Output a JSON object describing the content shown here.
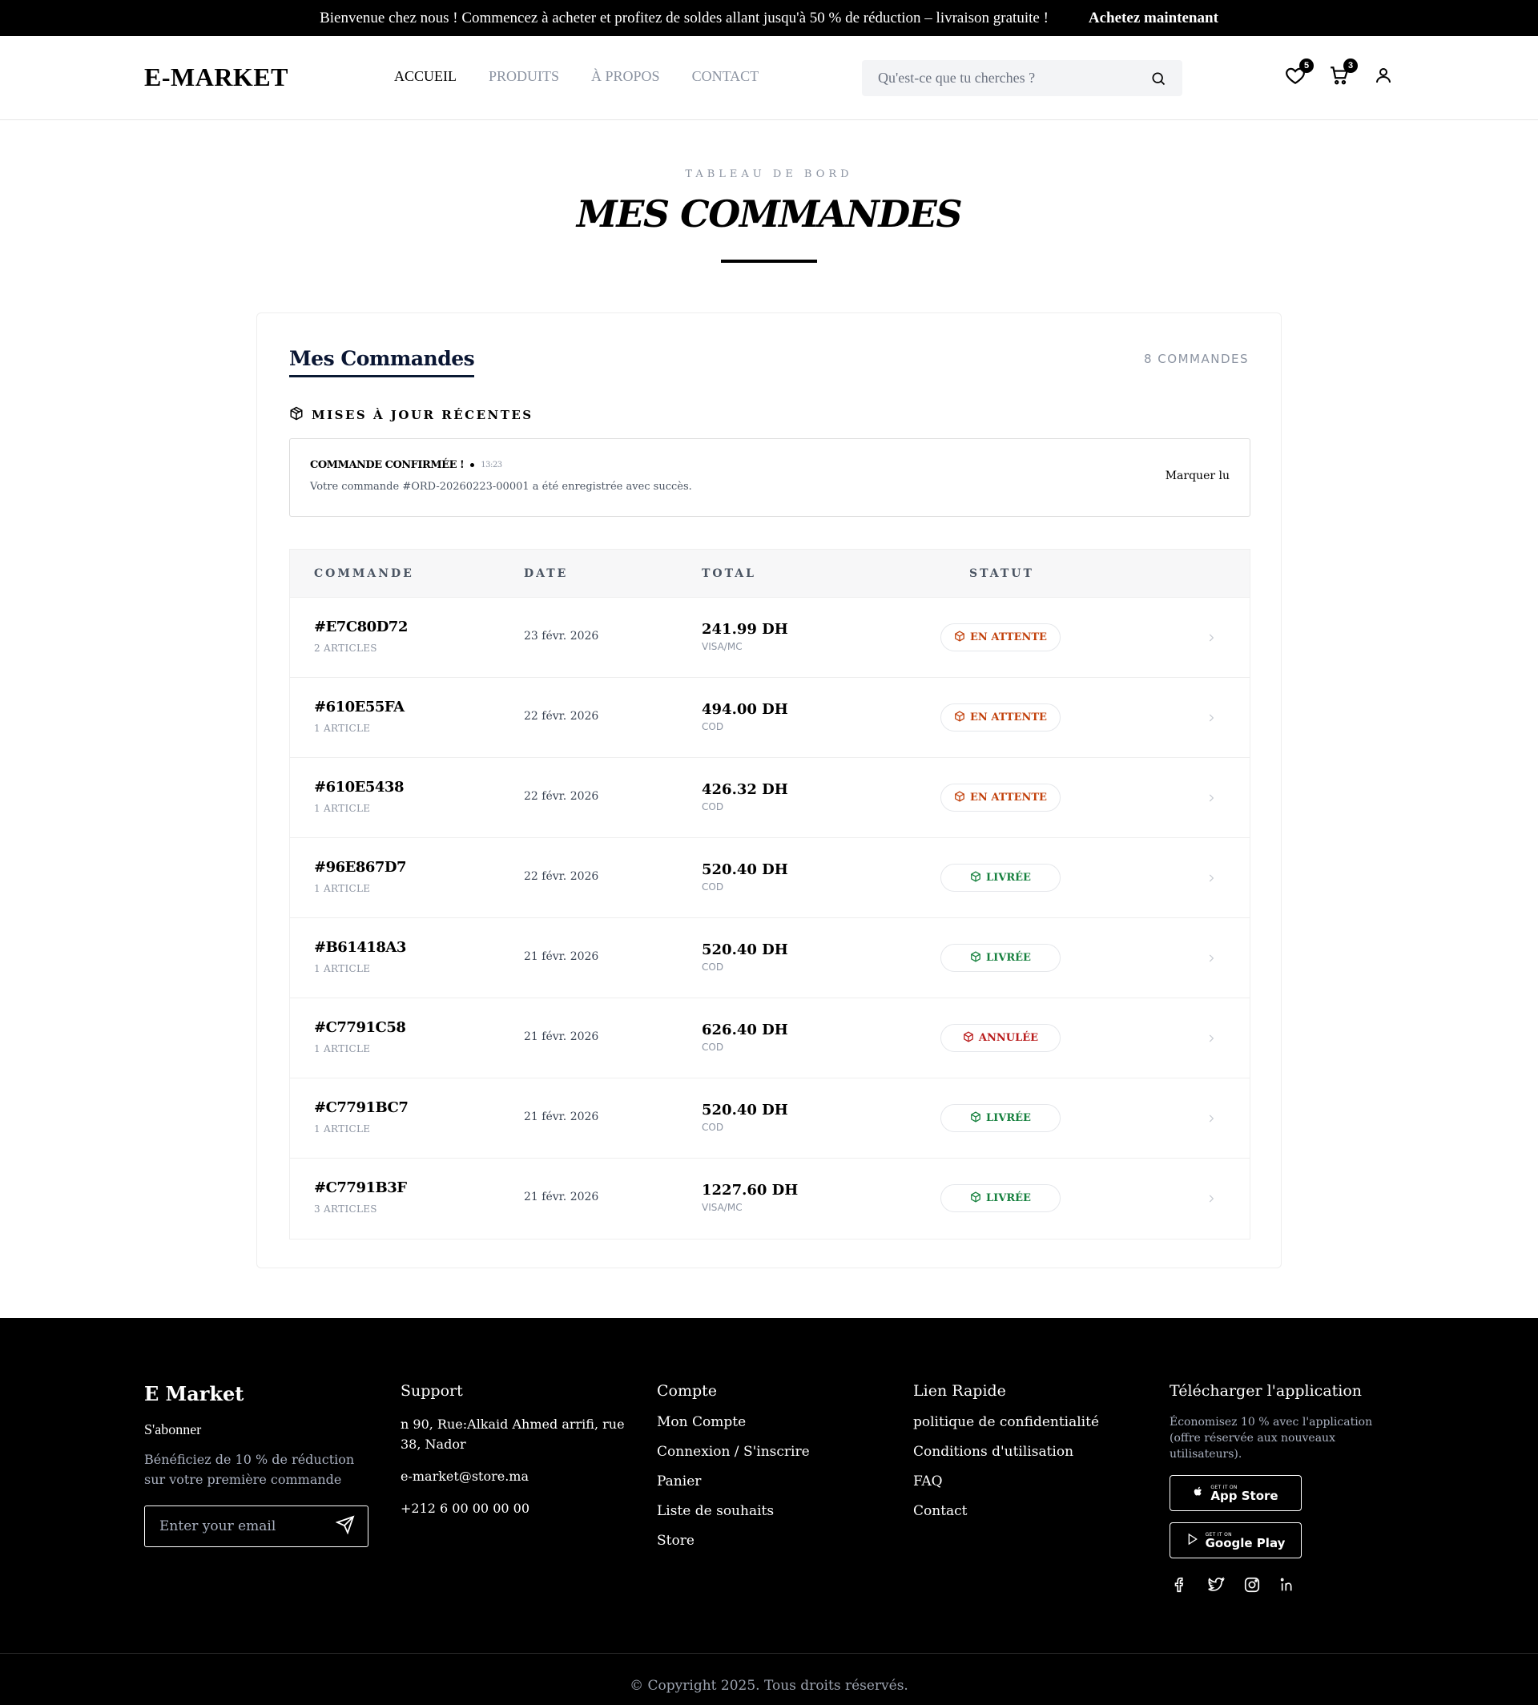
{
  "banner": {
    "message": "Bienvenue chez nous ! Commencez à acheter et profitez de soldes allant jusqu'à 50 % de réduction – livraison gratuite !",
    "cta": "Achetez maintenant"
  },
  "header": {
    "logo": "E-MARKET",
    "nav": [
      "ACCUEIL",
      "PRODUITS",
      "À PROPOS",
      "CONTACT"
    ],
    "search_placeholder": "Qu'est-ce que tu cherches ?",
    "wishlist_count": "5",
    "cart_count": "3",
    "icons": [
      "heart-icon",
      "cart-icon",
      "user-icon"
    ]
  },
  "page": {
    "eyebrow": "TABLEAU DE BORD",
    "title": "MES COMMANDES"
  },
  "card": {
    "title": "Mes Commandes",
    "count": "8 COMMANDES",
    "updates_title": "MISES À JOUR RÉCENTES",
    "notification": {
      "title": "COMMANDE CONFIRMÉE !",
      "time": "13:23",
      "message": "Votre commande #ORD-20260223-00001 a été enregistrée avec succès.",
      "action": "Marquer lu"
    }
  },
  "table": {
    "headers": [
      "COMMANDE",
      "DATE",
      "TOTAL",
      "STATUT"
    ],
    "rows": [
      {
        "id": "#E7C80D72",
        "items": "2 ARTICLES",
        "date": "23 févr. 2026",
        "total": "241.99 DH",
        "payment": "VISA/MC",
        "status": "EN ATTENTE",
        "status_type": "pending"
      },
      {
        "id": "#610E55FA",
        "items": "1 ARTICLE",
        "date": "22 févr. 2026",
        "total": "494.00 DH",
        "payment": "COD",
        "status": "EN ATTENTE",
        "status_type": "pending"
      },
      {
        "id": "#610E5438",
        "items": "1 ARTICLE",
        "date": "22 févr. 2026",
        "total": "426.32 DH",
        "payment": "COD",
        "status": "EN ATTENTE",
        "status_type": "pending"
      },
      {
        "id": "#96E867D7",
        "items": "1 ARTICLE",
        "date": "22 févr. 2026",
        "total": "520.40 DH",
        "payment": "COD",
        "status": "LIVRÉE",
        "status_type": "delivered"
      },
      {
        "id": "#B61418A3",
        "items": "1 ARTICLE",
        "date": "21 févr. 2026",
        "total": "520.40 DH",
        "payment": "COD",
        "status": "LIVRÉE",
        "status_type": "delivered"
      },
      {
        "id": "#C7791C58",
        "items": "1 ARTICLE",
        "date": "21 févr. 2026",
        "total": "626.40 DH",
        "payment": "COD",
        "status": "ANNULÉE",
        "status_type": "cancelled"
      },
      {
        "id": "#C7791BC7",
        "items": "1 ARTICLE",
        "date": "21 févr. 2026",
        "total": "520.40 DH",
        "payment": "COD",
        "status": "LIVRÉE",
        "status_type": "delivered"
      },
      {
        "id": "#C7791B3F",
        "items": "3 ARTICLES",
        "date": "21 févr. 2026",
        "total": "1227.60 DH",
        "payment": "VISA/MC",
        "status": "LIVRÉE",
        "status_type": "delivered"
      }
    ]
  },
  "colors": {
    "pending": "#c2410c",
    "delivered": "#15803d",
    "cancelled": "#b91c1c"
  },
  "footer": {
    "brand": "E Market",
    "subscribe": "S'abonner",
    "subscribe_desc": "Bénéficiez de 10 % de réduction sur votre première commande",
    "email_placeholder": "Enter your email",
    "support_title": "Support",
    "address": "n 90, Rue:Alkaid Ahmed arrifi, rue 38, Nador",
    "email": "e-market@store.ma",
    "phone": "+212 6 00 00 00 00",
    "account_title": "Compte",
    "account_links": [
      "Mon Compte",
      "Connexion / S'inscrire",
      "Panier",
      "Liste de souhaits",
      "Store"
    ],
    "quick_title": "Lien Rapide",
    "quick_links": [
      "politique de confidentialité",
      "Conditions d'utilisation",
      "FAQ",
      "Contact"
    ],
    "app_title": "Télécharger l'application",
    "app_desc": "Économisez 10 % avec l'application (offre réservée aux nouveaux utilisateurs).",
    "app_store_small": "GET IT ON",
    "app_store": "App Store",
    "google_play_small": "GET IT ON",
    "google_play": "Google Play",
    "social_icons": [
      "facebook-icon",
      "twitter-icon",
      "instagram-icon",
      "linkedin-icon"
    ],
    "copyright": "© Copyright 2025. Tous droits réservés."
  }
}
